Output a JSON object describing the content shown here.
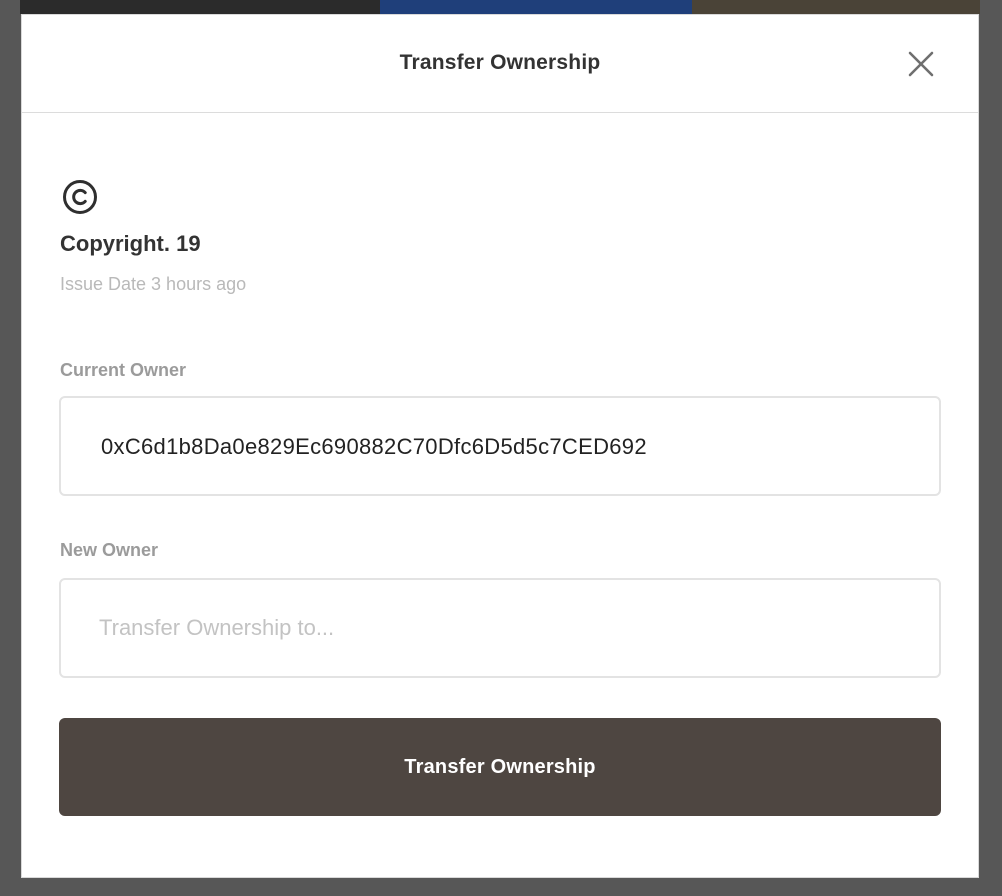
{
  "modal": {
    "title": "Transfer Ownership",
    "close_icon": "close-icon"
  },
  "item": {
    "icon": "copyright-icon",
    "title": "Copyright. 19",
    "issue_date": "Issue Date 3 hours ago"
  },
  "current_owner": {
    "label": "Current Owner",
    "value": "0xC6d1b8Da0e829Ec690882C70Dfc6D5d5c7CED692"
  },
  "new_owner": {
    "label": "New Owner",
    "value": "",
    "placeholder": "Transfer Ownership to..."
  },
  "submit": {
    "label": "Transfer Ownership"
  },
  "colors": {
    "button_bg": "#4e4641",
    "label_gray": "#9b9b9b",
    "placeholder_gray": "#c3c3c3",
    "title_dark": "#333333"
  }
}
